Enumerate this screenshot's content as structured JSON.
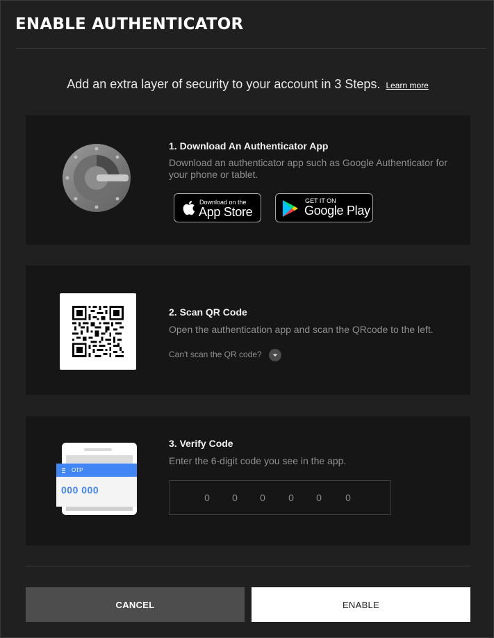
{
  "dialog": {
    "title": "ENABLE AUTHENTICATOR",
    "intro": "Add an extra layer of security to your account in 3 Steps.",
    "learn_more": "Learn more"
  },
  "steps": [
    {
      "title": "1. Download An Authenticator App",
      "description": "Download an authenticator app such as Google Authenticator for your phone or tablet.",
      "icon": "google-authenticator-icon",
      "app_store": {
        "small": "Download on the",
        "big": "App Store"
      },
      "google_play": {
        "small": "GET IT ON",
        "big": "Google Play"
      }
    },
    {
      "title": "2. Scan QR Code",
      "description": "Open the authentication app and scan the QRcode to the left.",
      "cant_scan": "Can't scan the QR code?"
    },
    {
      "title": "3. Verify Code",
      "description": "Enter the 6-digit code you see in the app.",
      "illustration": {
        "header": "OTP",
        "code": "000 000"
      },
      "code_placeholder": [
        "0",
        "0",
        "0",
        "0",
        "0",
        "0"
      ]
    }
  ],
  "buttons": {
    "cancel": "CANCEL",
    "enable": "ENABLE"
  },
  "colors": {
    "background": "#202020",
    "card": "#161616",
    "accent_blue": "#4285f4",
    "cancel_bg": "#4d4d4d",
    "enable_bg": "#ffffff"
  }
}
